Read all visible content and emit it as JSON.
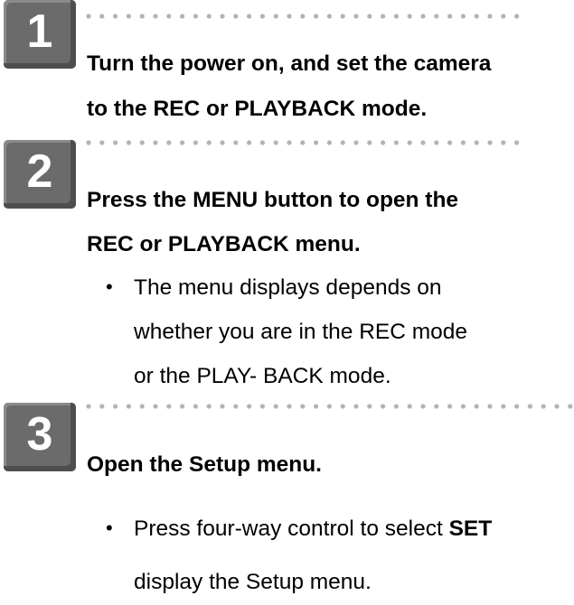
{
  "steps": [
    {
      "number": "1",
      "heading_line1": "Turn the power on, and set the camera",
      "heading_line2": "to the REC or PLAYBACK mode."
    },
    {
      "number": "2",
      "heading_line1": "Press the MENU button to open the",
      "heading_line2": "REC or PLAYBACK menu.",
      "bullet": {
        "symbol": "•",
        "line1": "The menu displays depends on",
        "line2": "whether you are in the REC mode",
        "line3": "or the PLAY- BACK mode."
      }
    },
    {
      "number": "3",
      "heading_line1": "Open the Setup menu.",
      "bullet": {
        "symbol": "•",
        "line1_prefix": "Press four-way control to select ",
        "line1_bold": "SET",
        "line2": "display the Setup menu."
      }
    }
  ],
  "colors": {
    "badge": "#6b6b6b",
    "dots": "#b3b3b3",
    "text": "#000000"
  }
}
